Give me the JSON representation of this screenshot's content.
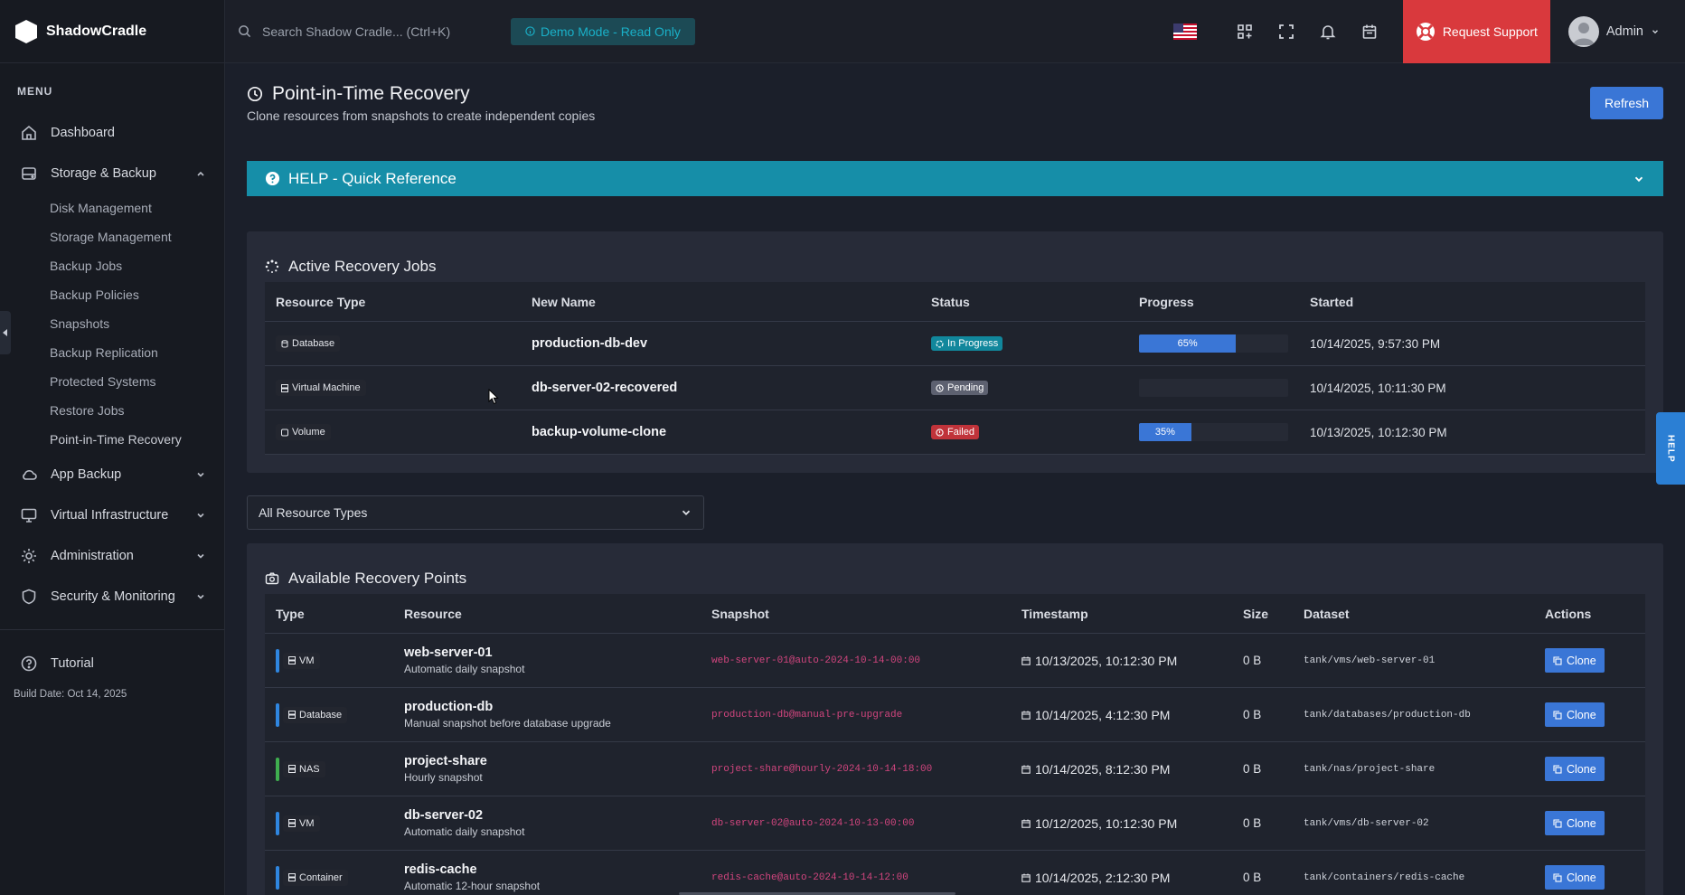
{
  "brand": {
    "name": "ShadowCradle"
  },
  "topbar": {
    "search_placeholder": "Search Shadow Cradle... (Ctrl+K)",
    "demo_label": "Demo Mode - Read Only",
    "support_label": "Request Support",
    "user_name": "Admin"
  },
  "sidebar": {
    "menu_title": "MENU",
    "dashboard": "Dashboard",
    "storage": "Storage & Backup",
    "sub_items": [
      "Disk Management",
      "Storage Management",
      "Backup Jobs",
      "Backup Policies",
      "Snapshots",
      "Backup Replication",
      "Protected Systems",
      "Restore Jobs",
      "Point-in-Time Recovery"
    ],
    "app_backup": "App Backup",
    "virtual": "Virtual Infrastructure",
    "admin": "Administration",
    "security": "Security & Monitoring",
    "tutorial": "Tutorial",
    "build_date": "Build Date: Oct 14, 2025"
  },
  "page": {
    "title": "Point-in-Time Recovery",
    "subtitle": "Clone resources from snapshots to create independent copies",
    "refresh_label": "Refresh",
    "help_label": "HELP - Quick Reference"
  },
  "jobs": {
    "title": "Active Recovery Jobs",
    "headers": [
      "Resource Type",
      "New Name",
      "Status",
      "Progress",
      "Started"
    ],
    "rows": [
      {
        "type": "Database",
        "name": "production-db-dev",
        "status": "In Progress",
        "progress": 65,
        "progress_label": "65%",
        "started": "10/14/2025, 9:57:30 PM"
      },
      {
        "type": "Virtual Machine",
        "name": "db-server-02-recovered",
        "status": "Pending",
        "progress": 0,
        "progress_label": "",
        "started": "10/14/2025, 10:11:30 PM"
      },
      {
        "type": "Volume",
        "name": "backup-volume-clone",
        "status": "Failed",
        "progress": 35,
        "progress_label": "35%",
        "started": "10/13/2025, 10:12:30 PM"
      }
    ]
  },
  "filter": {
    "selected": "All Resource Types"
  },
  "points": {
    "title": "Available Recovery Points",
    "headers": [
      "Type",
      "Resource",
      "Snapshot",
      "Timestamp",
      "Size",
      "Dataset",
      "Actions"
    ],
    "clone_label": "Clone",
    "rows": [
      {
        "type": "VM",
        "stripe": "#2f86e0",
        "resource": "web-server-01",
        "desc": "Automatic daily snapshot",
        "snapshot": "web-server-01@auto-2024-10-14-00:00",
        "timestamp": "10/13/2025, 10:12:30 PM",
        "size": "0 B",
        "dataset": "tank/vms/web-server-01"
      },
      {
        "type": "Database",
        "stripe": "#2f86e0",
        "resource": "production-db",
        "desc": "Manual snapshot before database upgrade",
        "snapshot": "production-db@manual-pre-upgrade",
        "timestamp": "10/14/2025, 4:12:30 PM",
        "size": "0 B",
        "dataset": "tank/databases/production-db"
      },
      {
        "type": "NAS",
        "stripe": "#3fae4f",
        "resource": "project-share",
        "desc": "Hourly snapshot",
        "snapshot": "project-share@hourly-2024-10-14-18:00",
        "timestamp": "10/14/2025, 8:12:30 PM",
        "size": "0 B",
        "dataset": "tank/nas/project-share"
      },
      {
        "type": "VM",
        "stripe": "#2f86e0",
        "resource": "db-server-02",
        "desc": "Automatic daily snapshot",
        "snapshot": "db-server-02@auto-2024-10-13-00:00",
        "timestamp": "10/12/2025, 10:12:30 PM",
        "size": "0 B",
        "dataset": "tank/vms/db-server-02"
      },
      {
        "type": "Container",
        "stripe": "#2f86e0",
        "resource": "redis-cache",
        "desc": "Automatic 12-hour snapshot",
        "snapshot": "redis-cache@auto-2024-10-14-12:00",
        "timestamp": "10/14/2025, 2:12:30 PM",
        "size": "0 B",
        "dataset": "tank/containers/redis-cache"
      }
    ]
  },
  "help_tab": "HELP"
}
